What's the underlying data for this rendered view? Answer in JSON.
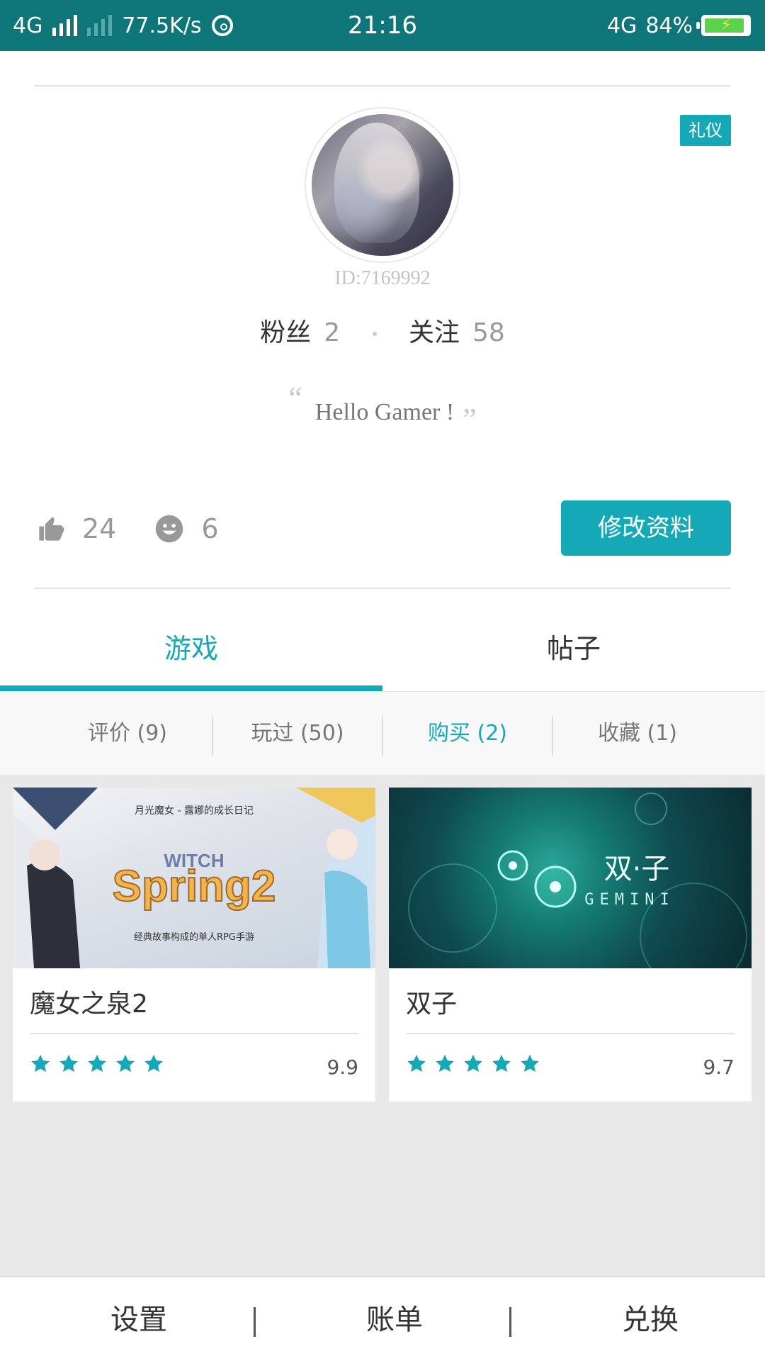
{
  "status_bar": {
    "network_left": "4G",
    "speed": "77.5K/s",
    "time": "21:16",
    "network_right": "4G",
    "battery": "84%"
  },
  "profile": {
    "badge": "礼仪",
    "user_id": "ID:7169992",
    "followers_label": "粉丝",
    "followers_count": "2",
    "following_label": "关注",
    "following_count": "58",
    "quote_open": "“",
    "bio": "Hello Gamer !",
    "quote_close": "”",
    "likes": "24",
    "smiles": "6",
    "edit_button": "修改资料"
  },
  "tabs": [
    {
      "label": "游戏",
      "active": true
    },
    {
      "label": "帖子",
      "active": false
    }
  ],
  "subtabs": [
    {
      "label": "评价 (9)",
      "active": false
    },
    {
      "label": "玩过 (50)",
      "active": false
    },
    {
      "label": "购买 (2)",
      "active": true
    },
    {
      "label": "收藏 (1)",
      "active": false
    }
  ],
  "games": [
    {
      "title": "魔女之泉2",
      "score": "9.9",
      "rating_stars": 5,
      "cover_text_top": "月光魔女 - 露娜的成长日记",
      "cover_logo": "WITCH Spring2",
      "cover_text_bottom": "经典故事构成的单人RPG手游"
    },
    {
      "title": "双子",
      "score": "9.7",
      "rating_stars": 5,
      "cover_logo": "双子",
      "cover_subtitle": "GEMINI"
    }
  ],
  "bottom_bar": [
    {
      "label": "设置"
    },
    {
      "label": "账单"
    },
    {
      "label": "兑换"
    }
  ],
  "colors": {
    "accent": "#15a9b8",
    "status_bar": "#0e7678"
  }
}
